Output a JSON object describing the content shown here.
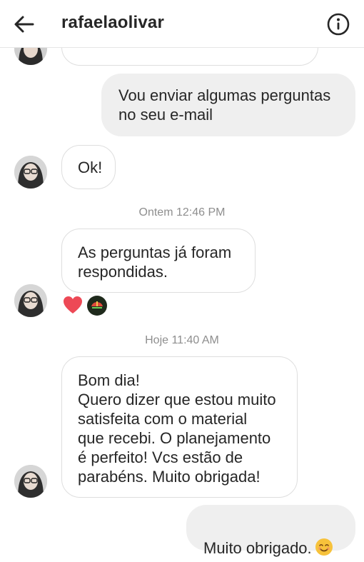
{
  "header": {
    "title": "rafaelaolivar"
  },
  "messages": {
    "m1": "Vou enviar algumas perguntas\nno seu e-mail",
    "m2": "Ok!",
    "m3": "As perguntas já foram\nrespondidas.",
    "m4": "Bom dia!\nQuero dizer que estou muito\nsatisfeita com o material\nque recebi. O planejamento\né perfeito! Vcs estão de\nparabéns. Muito obrigada!",
    "m5": "Muito obrigado."
  },
  "timestamps": {
    "t1": "Ontem 12:46 PM",
    "t2": "Hoje 11:40 AM"
  },
  "reactions": [
    "heart-emoji",
    "user-reaction-avatar"
  ],
  "colors": {
    "outgoing_bubble": "#efefef",
    "incoming_border": "#dedede",
    "heart": "#ed4956",
    "timestamp": "#8e8e8e"
  }
}
